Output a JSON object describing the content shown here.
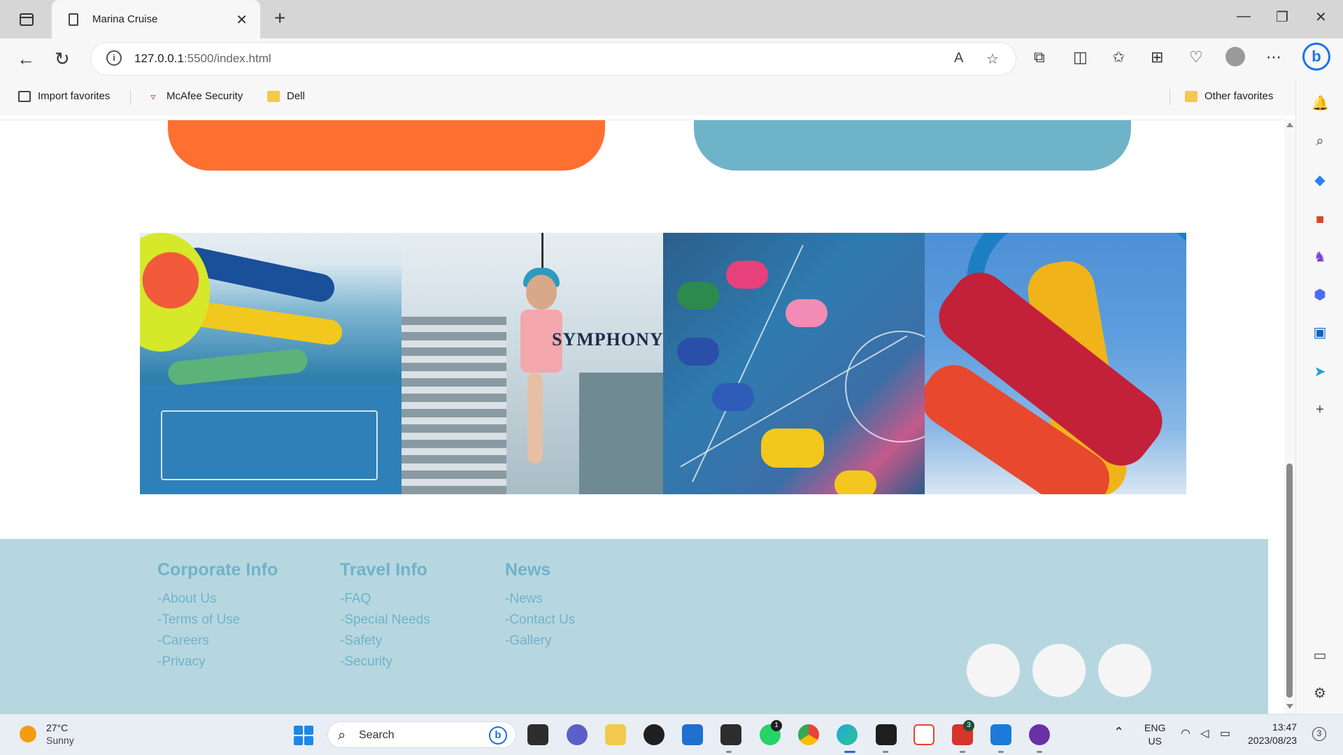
{
  "browser": {
    "tab_title": "Marina Cruise",
    "new_tab_label": "+",
    "tab_close_label": "✕",
    "url_host": "127.0.0.1",
    "url_path": ":5500/index.html",
    "minimize_label": "—",
    "restore_label": "❐",
    "close_label": "✕"
  },
  "favorites": {
    "items": [
      {
        "label": "Import favorites"
      },
      {
        "label": "McAfee Security"
      },
      {
        "label": "Dell"
      }
    ],
    "other": "Other favorites"
  },
  "gallery": {
    "sign_text": "SYMPHONY"
  },
  "footer": {
    "columns": [
      {
        "title": "Corporate Info",
        "links": [
          "-About Us",
          "-Terms of Use",
          "-Careers",
          "-Privacy"
        ]
      },
      {
        "title": "Travel Info",
        "links": [
          "-FAQ",
          "-Special Needs",
          "-Safety",
          "-Security"
        ]
      },
      {
        "title": "News",
        "links": [
          "-News",
          "-Contact Us",
          "-Gallery"
        ]
      }
    ]
  },
  "taskbar": {
    "weather_temp": "27°C",
    "weather_desc": "Sunny",
    "search_label": "Search",
    "whatsapp_badge": "1",
    "app_badge": "3",
    "lang": "ENG",
    "region": "US",
    "time": "13:47",
    "date": "2023/08/23",
    "notifications": "3"
  },
  "colors": {
    "orange": "#ff6f2f",
    "teal": "#6fb3c9",
    "footer_bg": "#b7d7e0"
  }
}
